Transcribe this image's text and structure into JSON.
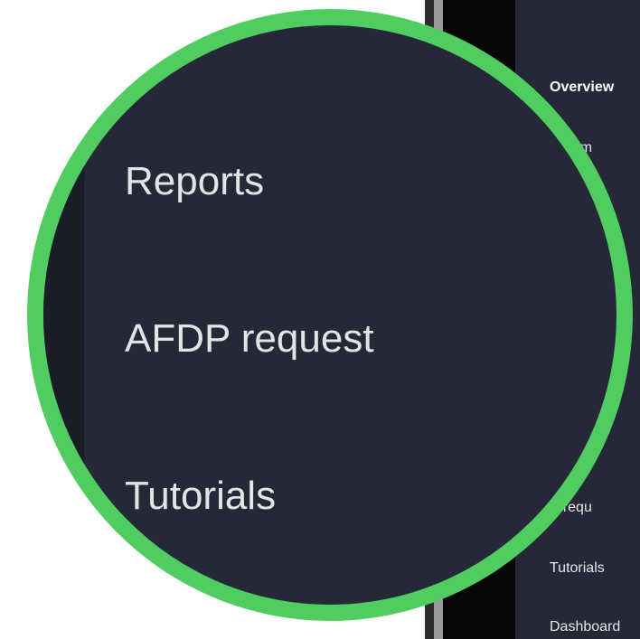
{
  "sidebar": {
    "items": [
      {
        "label": "Overview"
      },
      {
        "label": "ad film"
      },
      {
        "label": "P requ"
      },
      {
        "label": "Tutorials"
      },
      {
        "label": "Dashboard"
      }
    ]
  },
  "magnifier": {
    "items": [
      {
        "label": "Reports"
      },
      {
        "label": "AFDP request"
      },
      {
        "label": "Tutorials"
      }
    ],
    "ring_color": "#4fcd60",
    "bg_color": "#252836"
  }
}
